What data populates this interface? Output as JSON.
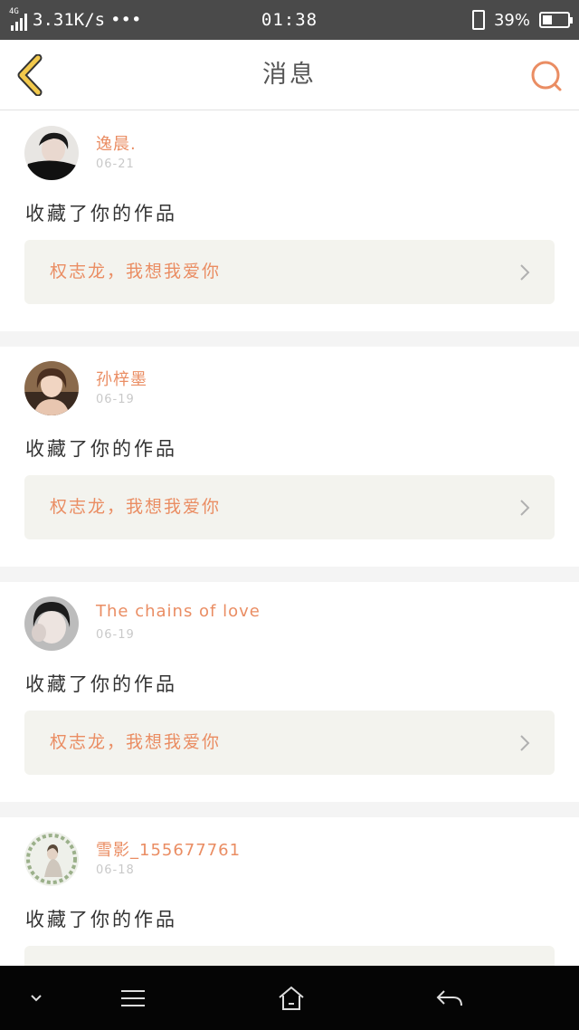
{
  "status_bar": {
    "network": "4G",
    "speed": "3.31K/s",
    "dots": "•••",
    "time": "01:38",
    "battery_percent": "39%",
    "battery_level": 0.39
  },
  "nav": {
    "title": "消息",
    "back_icon": "chevron-left-icon",
    "search_icon": "search-icon"
  },
  "messages": [
    {
      "name": "逸晨.",
      "date": "06-21",
      "action": "收藏了你的作品",
      "work": "权志龙，我想我爱你"
    },
    {
      "name": "孙梓墨",
      "date": "06-19",
      "action": "收藏了你的作品",
      "work": "权志龙，我想我爱你"
    },
    {
      "name": "The chains of love",
      "date": "06-19",
      "action": "收藏了你的作品",
      "work": "权志龙，我想我爱你"
    },
    {
      "name": "雪影_155677761",
      "date": "06-18",
      "action": "收藏了你的作品",
      "work": ""
    }
  ],
  "bottom_nav": [
    "chevron-down-icon",
    "menu-icon",
    "home-icon",
    "back-icon"
  ],
  "colors": {
    "accent": "#ea8d63",
    "back_icon": "#f2c94c",
    "status_bar": "#4a4a4a",
    "work_bg": "#f3f3ee"
  }
}
